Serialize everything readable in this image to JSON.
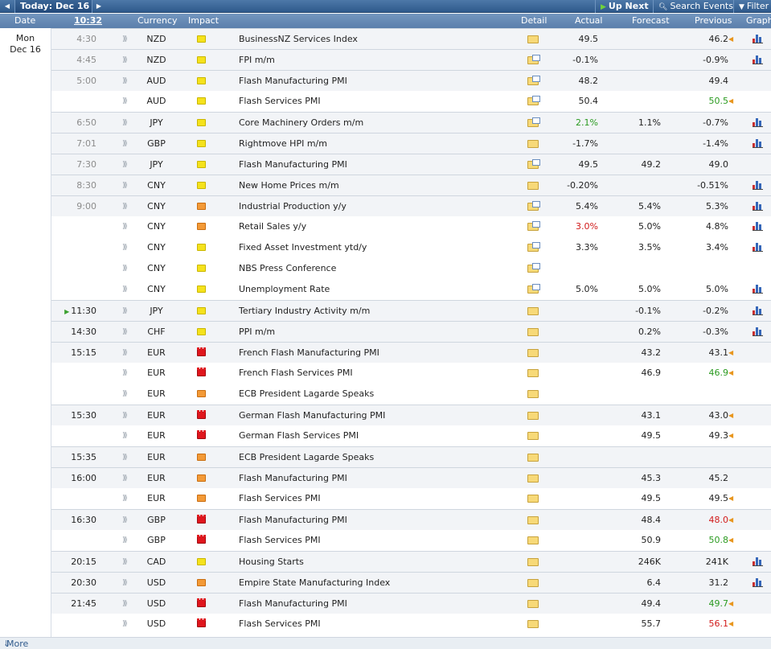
{
  "nav": {
    "prev_icon": "left-arrow-icon",
    "today_label": "Today: Dec 16",
    "next_icon": "right-arrow-icon",
    "up_next_label": "Up Next",
    "search_label": "Search Events",
    "filter_label": "Filter"
  },
  "columns": {
    "date": "Date",
    "time": "10:32",
    "currency": "Currency",
    "impact": "Impact",
    "detail": "Detail",
    "actual": "Actual",
    "forecast": "Forecast",
    "previous": "Previous",
    "graph": "Graph"
  },
  "date": {
    "weekday": "Mon",
    "day": "Dec 16"
  },
  "rows": [
    {
      "time": "4:30",
      "currency": "NZD",
      "impact": "low",
      "event": "BusinessNZ Services Index",
      "actual": "49.5",
      "forecast": "",
      "previous": "46.2",
      "previous_color": "",
      "revised": true,
      "graph": true,
      "group": true,
      "future": false,
      "now": false,
      "rich": false
    },
    {
      "time": "4:45",
      "currency": "NZD",
      "impact": "low",
      "event": "FPI m/m",
      "actual": "-0.1%",
      "forecast": "",
      "previous": "-0.9%",
      "previous_color": "",
      "revised": false,
      "graph": true,
      "group": true,
      "future": false,
      "now": false,
      "rich": true
    },
    {
      "time": "5:00",
      "currency": "AUD",
      "impact": "low",
      "event": "Flash Manufacturing PMI",
      "actual": "48.2",
      "forecast": "",
      "previous": "49.4",
      "previous_color": "",
      "revised": false,
      "graph": false,
      "group": true,
      "future": false,
      "now": false,
      "rich": true
    },
    {
      "time": "",
      "currency": "AUD",
      "impact": "low",
      "event": "Flash Services PMI",
      "actual": "50.4",
      "forecast": "",
      "previous": "50.5",
      "previous_color": "green",
      "revised": true,
      "graph": false,
      "group": false,
      "future": false,
      "now": false,
      "rich": true
    },
    {
      "time": "6:50",
      "currency": "JPY",
      "impact": "low",
      "event": "Core Machinery Orders m/m",
      "actual": "2.1%",
      "actual_color": "green",
      "forecast": "1.1%",
      "previous": "-0.7%",
      "previous_color": "",
      "revised": false,
      "graph": true,
      "group": true,
      "future": false,
      "now": false,
      "rich": true
    },
    {
      "time": "7:01",
      "currency": "GBP",
      "impact": "low",
      "event": "Rightmove HPI m/m",
      "actual": "-1.7%",
      "forecast": "",
      "previous": "-1.4%",
      "previous_color": "",
      "revised": false,
      "graph": true,
      "group": true,
      "future": false,
      "now": false,
      "rich": false
    },
    {
      "time": "7:30",
      "currency": "JPY",
      "impact": "low",
      "event": "Flash Manufacturing PMI",
      "actual": "49.5",
      "forecast": "49.2",
      "previous": "49.0",
      "previous_color": "",
      "revised": false,
      "graph": false,
      "group": true,
      "future": false,
      "now": false,
      "rich": true
    },
    {
      "time": "8:30",
      "currency": "CNY",
      "impact": "low",
      "event": "New Home Prices m/m",
      "actual": "-0.20%",
      "forecast": "",
      "previous": "-0.51%",
      "previous_color": "",
      "revised": false,
      "graph": true,
      "group": true,
      "future": false,
      "now": false,
      "rich": false
    },
    {
      "time": "9:00",
      "currency": "CNY",
      "impact": "med",
      "event": "Industrial Production y/y",
      "actual": "5.4%",
      "forecast": "5.4%",
      "previous": "5.3%",
      "previous_color": "",
      "revised": false,
      "graph": true,
      "group": true,
      "future": false,
      "now": false,
      "rich": true
    },
    {
      "time": "",
      "currency": "CNY",
      "impact": "med",
      "event": "Retail Sales y/y",
      "actual": "3.0%",
      "actual_color": "red",
      "forecast": "5.0%",
      "previous": "4.8%",
      "previous_color": "",
      "revised": false,
      "graph": true,
      "group": false,
      "future": false,
      "now": false,
      "rich": true
    },
    {
      "time": "",
      "currency": "CNY",
      "impact": "low",
      "event": "Fixed Asset Investment ytd/y",
      "actual": "3.3%",
      "forecast": "3.5%",
      "previous": "3.4%",
      "previous_color": "",
      "revised": false,
      "graph": true,
      "group": false,
      "future": false,
      "now": false,
      "rich": true
    },
    {
      "time": "",
      "currency": "CNY",
      "impact": "low",
      "event": "NBS Press Conference",
      "actual": "",
      "forecast": "",
      "previous": "",
      "previous_color": "",
      "revised": false,
      "graph": false,
      "group": false,
      "future": false,
      "now": false,
      "rich": true
    },
    {
      "time": "",
      "currency": "CNY",
      "impact": "low",
      "event": "Unemployment Rate",
      "actual": "5.0%",
      "forecast": "5.0%",
      "previous": "5.0%",
      "previous_color": "",
      "revised": false,
      "graph": true,
      "group": false,
      "future": false,
      "now": false,
      "rich": true
    },
    {
      "time": "11:30",
      "currency": "JPY",
      "impact": "low",
      "event": "Tertiary Industry Activity m/m",
      "actual": "",
      "forecast": "-0.1%",
      "previous": "-0.2%",
      "previous_color": "",
      "revised": false,
      "graph": true,
      "group": true,
      "future": true,
      "now": true,
      "rich": false
    },
    {
      "time": "14:30",
      "currency": "CHF",
      "impact": "low",
      "event": "PPI m/m",
      "actual": "",
      "forecast": "0.2%",
      "previous": "-0.3%",
      "previous_color": "",
      "revised": false,
      "graph": true,
      "group": true,
      "future": true,
      "now": false,
      "rich": false
    },
    {
      "time": "15:15",
      "currency": "EUR",
      "impact": "high",
      "event": "French Flash Manufacturing PMI",
      "actual": "",
      "forecast": "43.2",
      "previous": "43.1",
      "previous_color": "",
      "revised": true,
      "graph": false,
      "group": true,
      "future": true,
      "now": false,
      "rich": false
    },
    {
      "time": "",
      "currency": "EUR",
      "impact": "high",
      "event": "French Flash Services PMI",
      "actual": "",
      "forecast": "46.9",
      "previous": "46.9",
      "previous_color": "green",
      "revised": true,
      "graph": false,
      "group": false,
      "future": true,
      "now": false,
      "rich": false
    },
    {
      "time": "",
      "currency": "EUR",
      "impact": "med",
      "event": "ECB President Lagarde Speaks",
      "actual": "",
      "forecast": "",
      "previous": "",
      "previous_color": "",
      "revised": false,
      "graph": false,
      "group": false,
      "future": true,
      "now": false,
      "rich": false
    },
    {
      "time": "15:30",
      "currency": "EUR",
      "impact": "high",
      "event": "German Flash Manufacturing PMI",
      "actual": "",
      "forecast": "43.1",
      "previous": "43.0",
      "previous_color": "",
      "revised": true,
      "graph": false,
      "group": true,
      "future": true,
      "now": false,
      "rich": false
    },
    {
      "time": "",
      "currency": "EUR",
      "impact": "high",
      "event": "German Flash Services PMI",
      "actual": "",
      "forecast": "49.5",
      "previous": "49.3",
      "previous_color": "",
      "revised": true,
      "graph": false,
      "group": false,
      "future": true,
      "now": false,
      "rich": false
    },
    {
      "time": "15:35",
      "currency": "EUR",
      "impact": "med",
      "event": "ECB President Lagarde Speaks",
      "actual": "",
      "forecast": "",
      "previous": "",
      "previous_color": "",
      "revised": false,
      "graph": false,
      "group": true,
      "future": true,
      "now": false,
      "rich": false
    },
    {
      "time": "16:00",
      "currency": "EUR",
      "impact": "med",
      "event": "Flash Manufacturing PMI",
      "actual": "",
      "forecast": "45.3",
      "previous": "45.2",
      "previous_color": "",
      "revised": false,
      "graph": false,
      "group": true,
      "future": true,
      "now": false,
      "rich": false
    },
    {
      "time": "",
      "currency": "EUR",
      "impact": "med",
      "event": "Flash Services PMI",
      "actual": "",
      "forecast": "49.5",
      "previous": "49.5",
      "previous_color": "",
      "revised": true,
      "graph": false,
      "group": false,
      "future": true,
      "now": false,
      "rich": false
    },
    {
      "time": "16:30",
      "currency": "GBP",
      "impact": "high",
      "event": "Flash Manufacturing PMI",
      "actual": "",
      "forecast": "48.4",
      "previous": "48.0",
      "previous_color": "red",
      "revised": true,
      "graph": false,
      "group": true,
      "future": true,
      "now": false,
      "rich": false
    },
    {
      "time": "",
      "currency": "GBP",
      "impact": "high",
      "event": "Flash Services PMI",
      "actual": "",
      "forecast": "50.9",
      "previous": "50.8",
      "previous_color": "green",
      "revised": true,
      "graph": false,
      "group": false,
      "future": true,
      "now": false,
      "rich": false
    },
    {
      "time": "20:15",
      "currency": "CAD",
      "impact": "low",
      "event": "Housing Starts",
      "actual": "",
      "forecast": "246K",
      "previous": "241K",
      "previous_color": "",
      "revised": false,
      "graph": true,
      "group": true,
      "future": true,
      "now": false,
      "rich": false
    },
    {
      "time": "20:30",
      "currency": "USD",
      "impact": "med",
      "event": "Empire State Manufacturing Index",
      "actual": "",
      "forecast": "6.4",
      "previous": "31.2",
      "previous_color": "",
      "revised": false,
      "graph": true,
      "group": true,
      "future": true,
      "now": false,
      "rich": false
    },
    {
      "time": "21:45",
      "currency": "USD",
      "impact": "high",
      "event": "Flash Manufacturing PMI",
      "actual": "",
      "forecast": "49.4",
      "previous": "49.7",
      "previous_color": "green",
      "revised": true,
      "graph": false,
      "group": true,
      "future": true,
      "now": false,
      "rich": false
    },
    {
      "time": "",
      "currency": "USD",
      "impact": "high",
      "event": "Flash Services PMI",
      "actual": "",
      "forecast": "55.7",
      "previous": "56.1",
      "previous_color": "red",
      "revised": true,
      "graph": false,
      "group": false,
      "future": true,
      "now": false,
      "rich": false
    }
  ],
  "footer": {
    "more_label": "More"
  }
}
